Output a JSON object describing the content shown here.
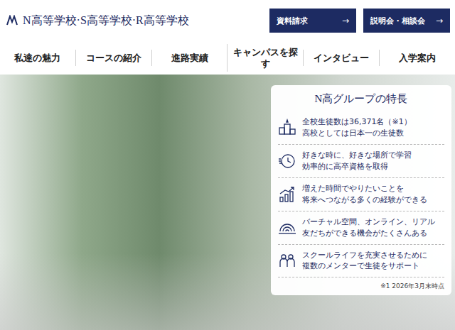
{
  "header": {
    "logo": "N高等学校·S高等学校·R高等学校",
    "buttons": [
      {
        "label": "資料請求",
        "arrow": "→"
      },
      {
        "label": "説明会・相談会",
        "arrow": "→"
      }
    ]
  },
  "nav": {
    "items": [
      "私達の魅力",
      "コースの紹介",
      "進路実績",
      "キャンパスを探す",
      "インタビュー",
      "入学案内"
    ]
  },
  "hero": {
    "card": {
      "title": "N高グループの特長",
      "features": [
        {
          "icon": "podium",
          "lines": [
            "全校生徒数は36,371名（※1）",
            "高校としては日本一の生徒数"
          ]
        },
        {
          "icon": "clock",
          "lines": [
            "好きな時に、好きな場所で学習",
            "効率的に高卒資格を取得"
          ]
        },
        {
          "icon": "growth",
          "lines": [
            "増えた時間でやりたいことを",
            "将来へつながる多くの経験ができる"
          ]
        },
        {
          "icon": "network",
          "lines": [
            "バーチャル空間、オンライン、リアル",
            "友だちができる機会がたくさんある"
          ]
        },
        {
          "icon": "people",
          "lines": [
            "スクールライフを充実させるために",
            "複数のメンターで生徒をサポート"
          ]
        }
      ],
      "footnote": "※1 2026年3月末時点"
    }
  }
}
